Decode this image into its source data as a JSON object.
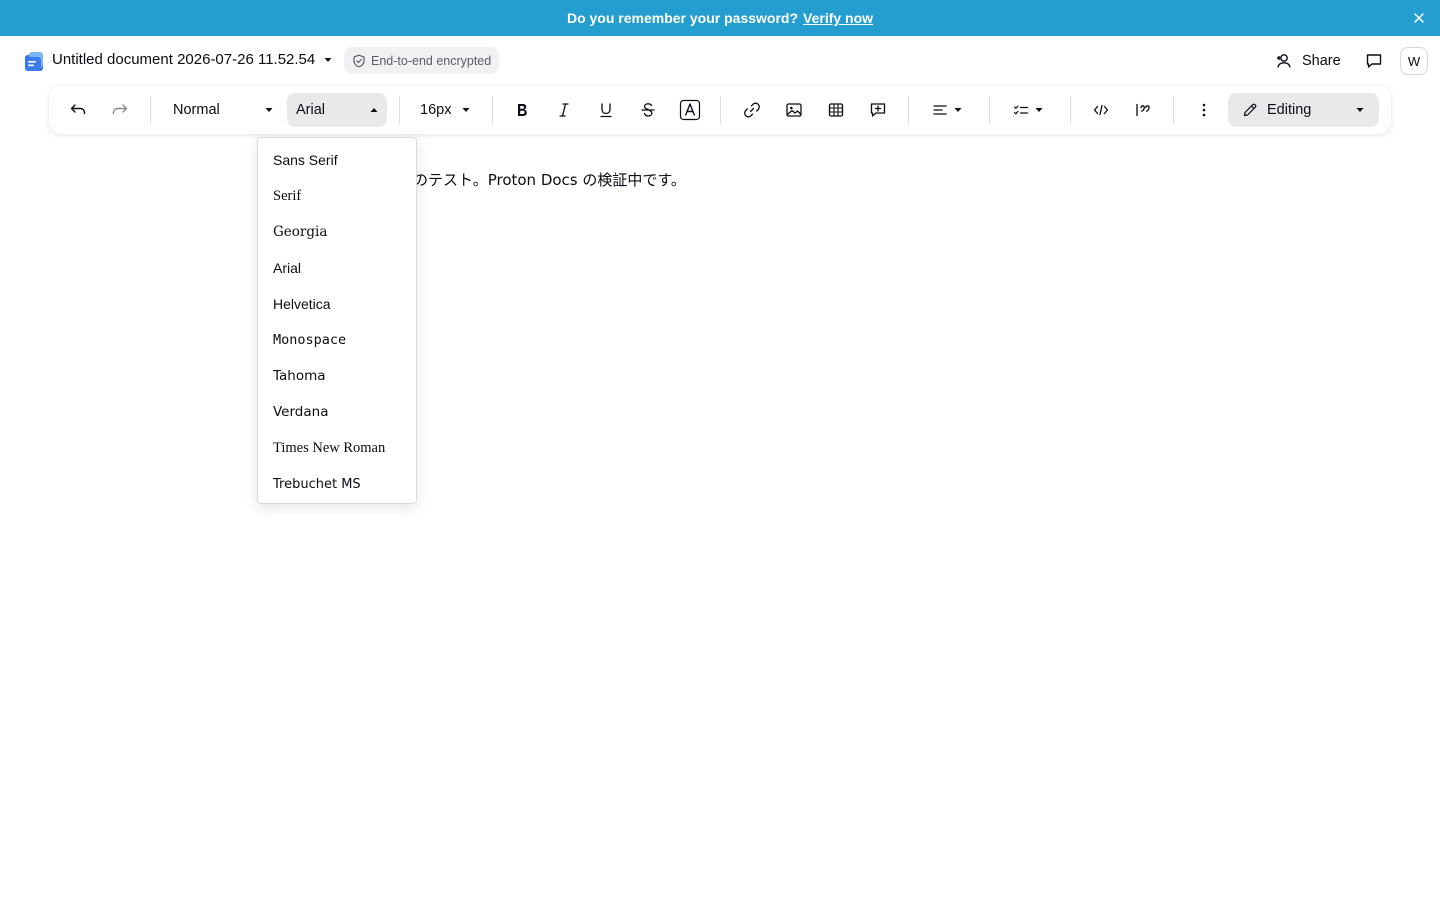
{
  "banner": {
    "message": "Do you remember your password?",
    "link": "Verify now",
    "close_icon": "close-icon",
    "background": "#239ece"
  },
  "header": {
    "doc_title": "Untitled document 2026-07-26 11.52.54",
    "encryption_badge": "End-to-end encrypted",
    "share_label": "Share",
    "avatar_initial": "W"
  },
  "toolbar": {
    "style_value": "Normal",
    "font_value": "Arial",
    "size_value": "16px",
    "mode_value": "Editing",
    "icons": [
      "undo-icon",
      "redo-icon",
      "bold-icon",
      "italic-icon",
      "underline-icon",
      "strikethrough-icon",
      "text-color-icon",
      "link-icon",
      "image-icon",
      "table-icon",
      "add-comment-icon",
      "align-left-icon",
      "list-icon",
      "code-icon",
      "quote-icon",
      "more-icon",
      "pencil-icon"
    ]
  },
  "editor": {
    "text": "のテスト。Proton Docs の検証中です。"
  },
  "font_menu": {
    "items": [
      "Sans Serif",
      "Serif",
      "Georgia",
      "Arial",
      "Helvetica",
      "Monospace",
      "Tahoma",
      "Verdana",
      "Times New Roman",
      "Trebuchet MS"
    ]
  }
}
